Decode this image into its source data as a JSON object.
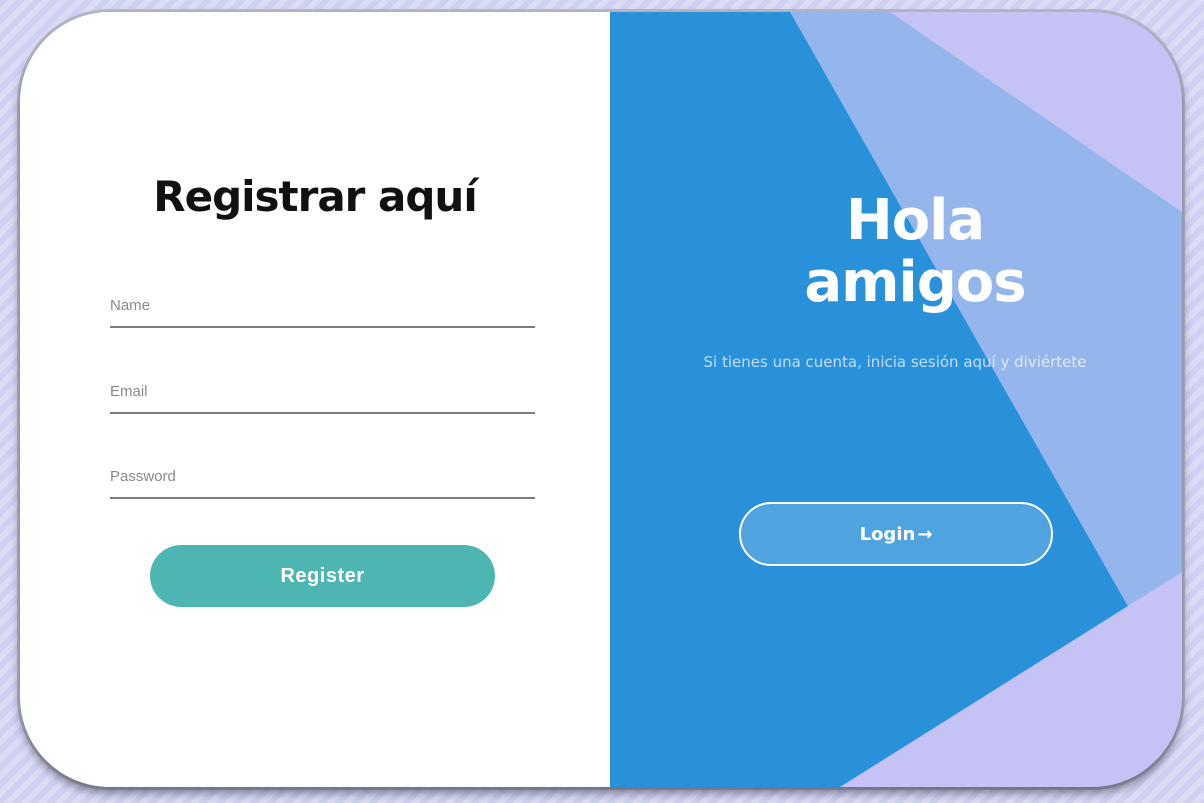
{
  "register": {
    "title": "Registrar aquí",
    "fields": {
      "name_placeholder": "Name",
      "email_placeholder": "Email",
      "password_placeholder": "Password"
    },
    "button_label": "Register"
  },
  "welcome": {
    "title_line1": "Hola",
    "title_line2": "amigos",
    "subtitle": "Si tienes una cuenta, inicia sesión aquí y diviértete",
    "login_label": "Login",
    "login_icon": "arrow-right-icon"
  },
  "colors": {
    "panel_blue": "#2990da",
    "register_button": "#4db6b3",
    "lavender_shape": "#c5c2f6",
    "light_blue_shape": "#95b6ec"
  }
}
